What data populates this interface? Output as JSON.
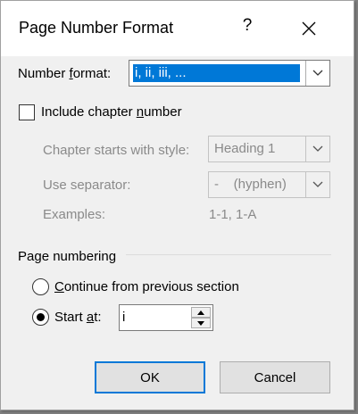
{
  "dialog": {
    "title": "Page Number Format",
    "help": "?"
  },
  "number_format": {
    "label_pre": "Number ",
    "label_u": "f",
    "label_post": "ormat:",
    "value": "i, ii, iii, ..."
  },
  "include_chapter": {
    "label_pre": "Include chapter ",
    "label_u": "n",
    "label_post": "umber",
    "checked": false
  },
  "chapter_style": {
    "label": "Chapter starts with style:",
    "value": "Heading 1"
  },
  "separator": {
    "label": "Use separator:",
    "value": "-    (hyphen)"
  },
  "examples": {
    "label": "Examples:",
    "value": "1-1, 1-A"
  },
  "page_numbering": {
    "heading": "Page numbering",
    "continue_u": "C",
    "continue_post": "ontinue from previous section",
    "start_pre": "Start ",
    "start_u": "a",
    "start_post": "t:",
    "start_value": "i",
    "selected": "start_at"
  },
  "buttons": {
    "ok": "OK",
    "cancel": "Cancel"
  },
  "colors": {
    "selection": "#0078d7",
    "dialog_bg": "#f0f0f0"
  }
}
